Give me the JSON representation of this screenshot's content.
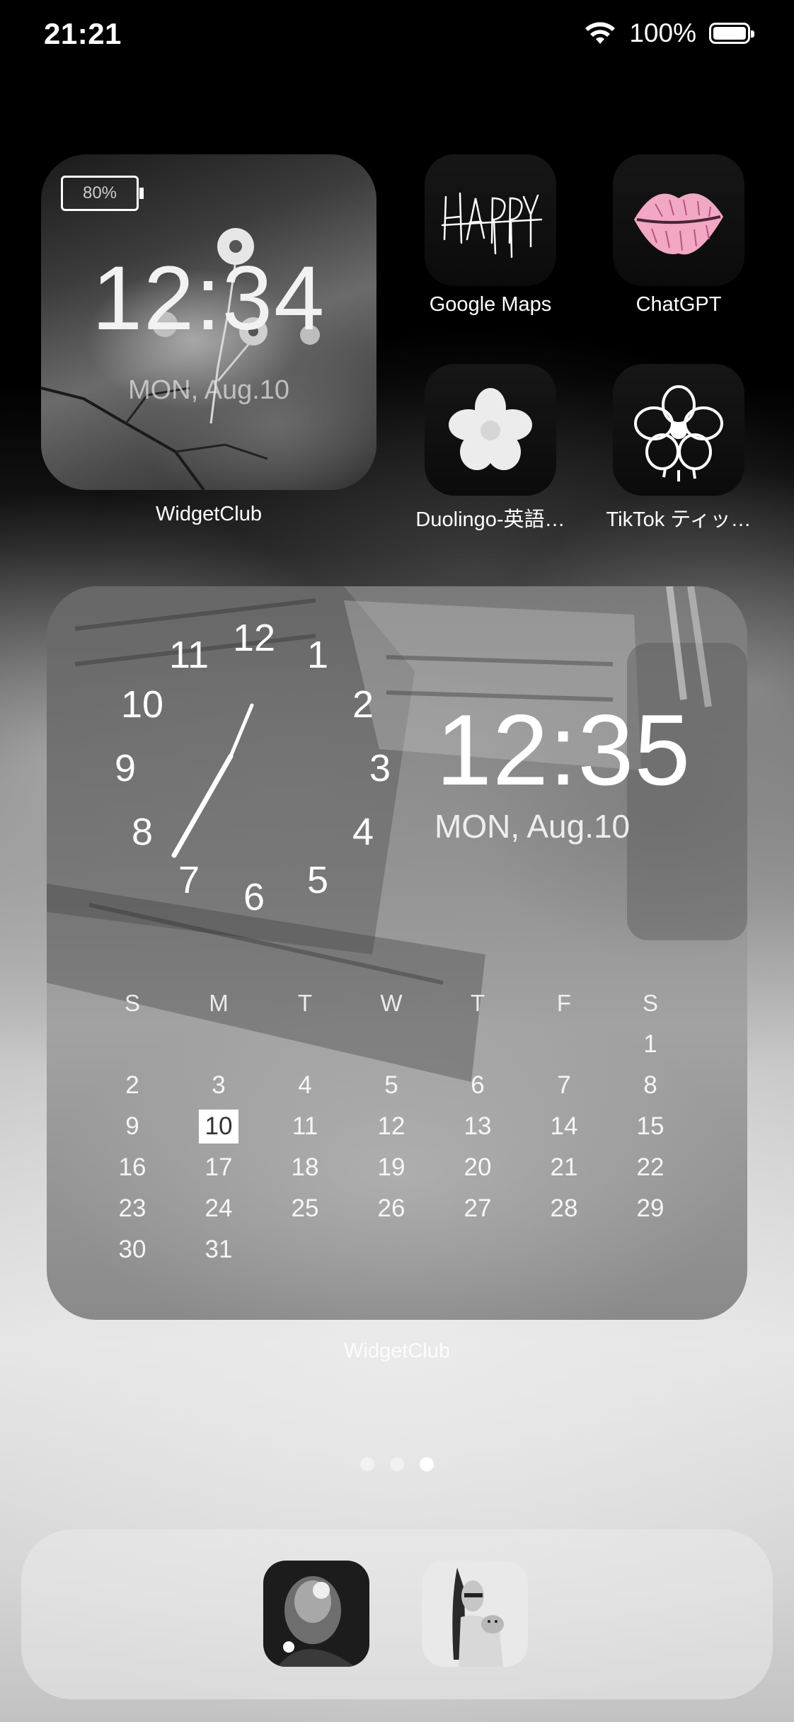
{
  "status_bar": {
    "time": "21:21",
    "battery_percent": "100%",
    "icons": [
      "wifi-icon",
      "battery-icon"
    ]
  },
  "small_widget": {
    "battery_label": "80%",
    "time": "12:34",
    "date": "MON, Aug.10",
    "app_label": "WidgetClub"
  },
  "apps": [
    {
      "label": "Google Maps",
      "icon": "happy-text-icon"
    },
    {
      "label": "ChatGPT",
      "icon": "lips-icon"
    },
    {
      "label": "Duolingo-英語…",
      "icon": "flower-icon"
    },
    {
      "label": "TikTok ティッ…",
      "icon": "flower-outline-icon"
    }
  ],
  "large_widget": {
    "dial_numbers": [
      "12",
      "1",
      "2",
      "3",
      "4",
      "5",
      "6",
      "7",
      "8",
      "9",
      "10",
      "11"
    ],
    "time": "12:35",
    "date": "MON, Aug.10",
    "weekdays": [
      "S",
      "M",
      "T",
      "W",
      "T",
      "F",
      "S"
    ],
    "weeks": [
      [
        "",
        "",
        "",
        "",
        "",
        "",
        "1"
      ],
      [
        "2",
        "3",
        "4",
        "5",
        "6",
        "7",
        "8"
      ],
      [
        "9",
        "10",
        "11",
        "12",
        "13",
        "14",
        "15"
      ],
      [
        "16",
        "17",
        "18",
        "19",
        "20",
        "21",
        "22"
      ],
      [
        "23",
        "24",
        "25",
        "26",
        "27",
        "28",
        "29"
      ],
      [
        "30",
        "31",
        "",
        "",
        "",
        "",
        ""
      ]
    ],
    "today": "10",
    "app_label": "WidgetClub"
  },
  "page_dots": {
    "count": 3,
    "active": 3
  },
  "dock": {
    "apps": [
      {
        "icon": "photo-portrait-icon"
      },
      {
        "icon": "photo-portrait-dog-icon"
      }
    ]
  }
}
